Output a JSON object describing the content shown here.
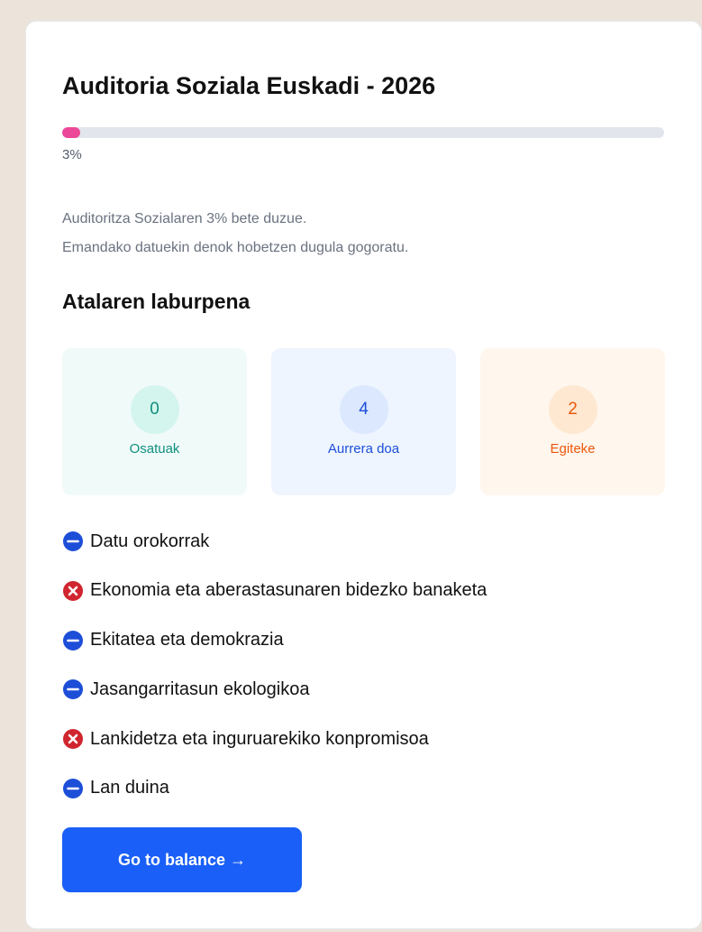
{
  "card": {
    "title": "Auditoria Soziala Euskadi - 2026",
    "progress": {
      "percent": 3,
      "label": "3%",
      "fill_color": "#ec4899",
      "track_color": "#e2e6ec"
    },
    "description": [
      "Auditoritza Sozialaren 3% bete duzue.",
      "Emandako datuekin denok hobetzen dugula gogoratu."
    ],
    "summary_title": "Atalaren laburpena",
    "stats": [
      {
        "id": "completed",
        "value": "0",
        "label": "Osatuak",
        "bg": "#f0faf9",
        "circle_bg": "#d4f5ee",
        "color": "#0f8f7e"
      },
      {
        "id": "in-progress",
        "value": "4",
        "label": "Aurrera doa",
        "bg": "#eef5ff",
        "circle_bg": "#dbe8fe",
        "color": "#1d4ed8"
      },
      {
        "id": "pending",
        "value": "2",
        "label": "Egiteke",
        "bg": "#fff6ed",
        "circle_bg": "#ffe8d1",
        "color": "#ea580c"
      }
    ],
    "sections": [
      {
        "label": "Datu orokorrak",
        "status": "in-progress",
        "icon": "minus-circle-icon"
      },
      {
        "label": "Ekonomia eta aberastasunaren bidezko banaketa",
        "status": "pending",
        "icon": "x-circle-icon"
      },
      {
        "label": "Ekitatea eta demokrazia",
        "status": "in-progress",
        "icon": "minus-circle-icon"
      },
      {
        "label": "Jasangarritasun ekologikoa",
        "status": "in-progress",
        "icon": "minus-circle-icon"
      },
      {
        "label": "Lankidetza eta inguruarekiko konpromisoa",
        "status": "pending",
        "icon": "x-circle-icon"
      },
      {
        "label": "Lan duina",
        "status": "in-progress",
        "icon": "minus-circle-icon"
      }
    ],
    "status_colors": {
      "in-progress": "#1d4ed8",
      "pending": "#d0262f"
    },
    "cta": {
      "label": "Go to balance →",
      "color": "#1a5ff7"
    }
  }
}
